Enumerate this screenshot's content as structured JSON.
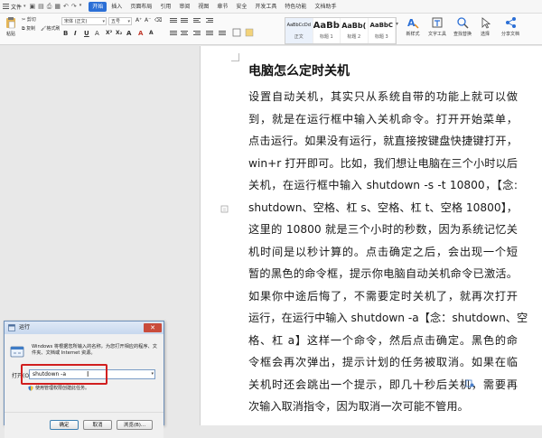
{
  "menubar": {
    "file_label": "文件",
    "tabs": [
      {
        "label": "开始",
        "active": true
      },
      {
        "label": "插入",
        "active": false
      },
      {
        "label": "页面布局",
        "active": false
      },
      {
        "label": "引用",
        "active": false
      },
      {
        "label": "审阅",
        "active": false
      },
      {
        "label": "视图",
        "active": false
      },
      {
        "label": "章节",
        "active": false
      },
      {
        "label": "安全",
        "active": false
      },
      {
        "label": "开发工具",
        "active": false
      },
      {
        "label": "特色功能",
        "active": false
      },
      {
        "label": "文档助手",
        "active": false
      }
    ],
    "accent_color": "#2b6fd6"
  },
  "ribbon": {
    "paste_label": "粘贴",
    "cut_label": "剪切",
    "copy_label": "复制",
    "format_painter_label": "格式刷",
    "font_name": "宋体 (正文)",
    "font_size": "五号",
    "styles": [
      {
        "sample": "AaBbCcDd",
        "name": "正文"
      },
      {
        "sample": "AaBb",
        "name": "标题 1"
      },
      {
        "sample": "AaBb(",
        "name": "标题 2"
      },
      {
        "sample": "AaBbC",
        "name": "标题 3"
      }
    ],
    "new_style_label": "新样式",
    "text_tools_label": "文字工具",
    "find_replace_label": "查找替换",
    "select_label": "选择",
    "share_label": "分享文档"
  },
  "document": {
    "title": "电脑怎么定时关机",
    "lines": [
      "设置自动关机，其实只从系统自带的功能上就可以做",
      "到，就是在运行框中输入关机命令。打开开始菜单，",
      "点击运行。如果没有运行，就直接按键盘快捷键打开，",
      "win+r 打开即可。比如，我们想让电脑在三个小时以后",
      "关机，在运行框中输入 shutdown -s -t 10800，【念:",
      "shutdown、空格、杠 s、空格、杠 t、空格 10800】，",
      "这里的 10800 就是三个小时的秒数，因为系统记忆关",
      "机时间是以秒计算的。点击确定之后，会出现一个短",
      "暂的黑色的命令框，提示你电脑自动关机命令已激活。",
      "如果你中途后悔了，不需要定时关机了，就再次打开",
      "运行，在运行中输入 shutdown -a【念：shutdown、空",
      "格、杠 a】这样一个命令，然后点击确定。黑色的命",
      "令框会再次弹出，提示计划的任务被取消。如果在临",
      "关机时还会跳出一个提示，即几十秒后关机，需要再",
      "次输入取消指令，因为取消一次可能不管用。"
    ]
  },
  "run_dialog": {
    "title": "运行",
    "description": "Windows 将根据您所输入的名称，为您打开相应的程序、文件夹、文档或 Internet 资源。",
    "open_label": "打开(O):",
    "input_value": "shutdown -a",
    "admin_note": "使用管理权限创建此任务。",
    "ok_label": "确定",
    "cancel_label": "取消",
    "browse_label": "浏览(B)...",
    "highlight_color": "#d11f1f"
  }
}
